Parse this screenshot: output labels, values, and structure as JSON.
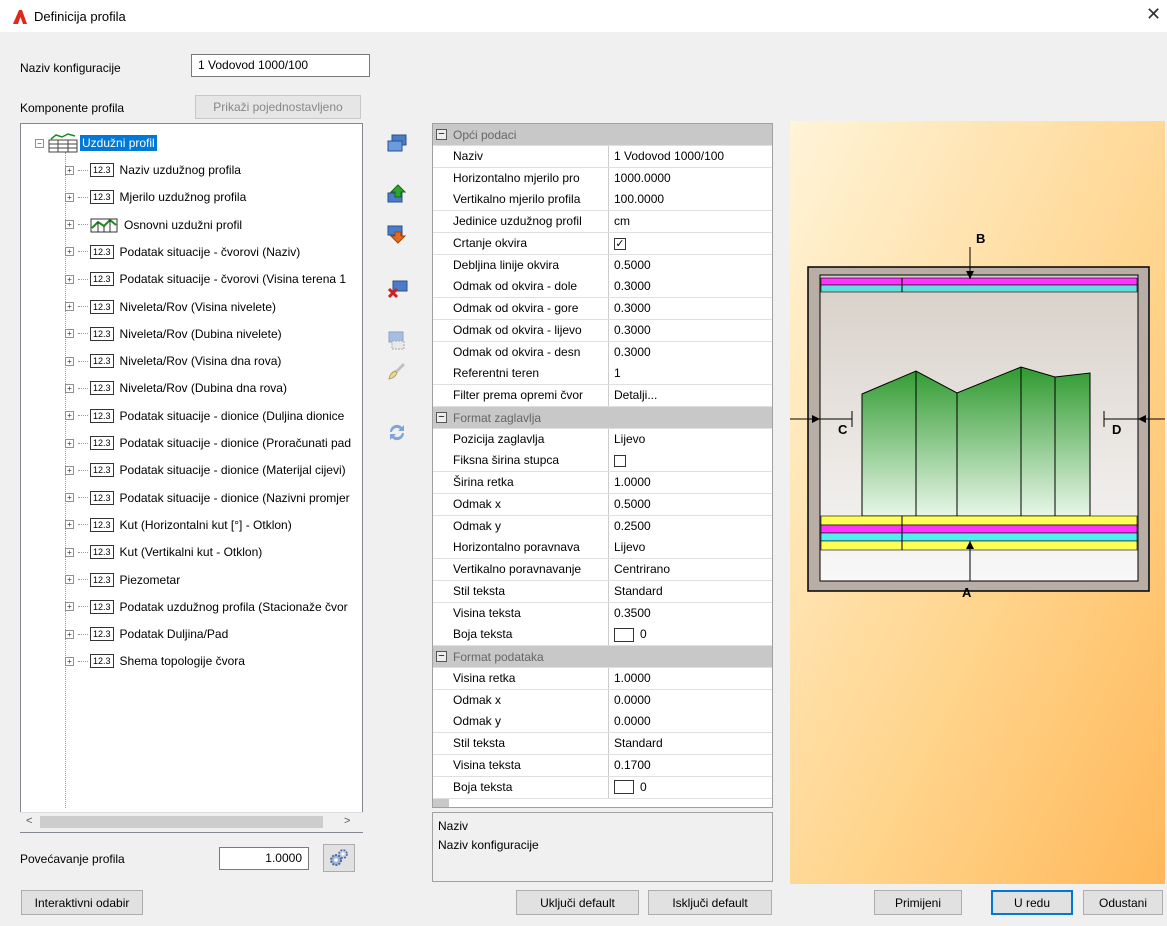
{
  "window": {
    "title": "Definicija profila"
  },
  "config": {
    "label": "Naziv konfiguracije",
    "value": "1 Vodovod 1000/100"
  },
  "components": {
    "label": "Komponente profila",
    "simplified_button": "Prikaži pojednostavljeno"
  },
  "tree": {
    "root": "Uzdužni profil",
    "icon_badge": "12.3",
    "items": [
      "Naziv uzdužnog profila",
      "Mjerilo uzdužnog profila",
      "Osnovni uzdužni profil",
      "Podatak situacije - čvorovi (Naziv)",
      "Podatak situacije - čvorovi (Visina terena 1",
      "Niveleta/Rov (Visina nivelete)",
      "Niveleta/Rov (Dubina nivelete)",
      "Niveleta/Rov (Visina dna rova)",
      "Niveleta/Rov (Dubina dna rova)",
      "Podatak situacije - dionice (Duljina dionice",
      "Podatak situacije - dionice (Proračunati pad",
      "Podatak situacije - dionice (Materijal cijevi)",
      "Podatak situacije - dionice (Nazivni promjer",
      "Kut (Horizontalni kut [°] - Otklon)",
      "Kut (Vertikalni kut - Otklon)",
      "Piezometar",
      "Podatak uzdužnog profila (Stacionaže čvor",
      "Podatak Duljina/Pad",
      "Shema topologije čvora"
    ]
  },
  "zoom": {
    "label": "Povećavanje profila",
    "value": "1.0000"
  },
  "props": {
    "general": {
      "title": "Opći podaci",
      "rows": [
        {
          "name": "Naziv",
          "value": "1 Vodovod 1000/100"
        },
        {
          "name": "Horizontalno mjerilo pro",
          "value": "1000.0000"
        },
        {
          "name": "Vertikalno mjerilo profila",
          "value": "100.0000"
        },
        {
          "name": "Jedinice uzdužnog profil",
          "value": "cm"
        },
        {
          "name": "Crtanje okvira",
          "value": "",
          "checked": true
        },
        {
          "name": "Debljina linije okvira",
          "value": "0.5000"
        },
        {
          "name": "Odmak od okvira - dole",
          "value": "0.3000"
        },
        {
          "name": "Odmak od okvira - gore",
          "value": "0.3000"
        },
        {
          "name": "Odmak od okvira - lijevo",
          "value": "0.3000"
        },
        {
          "name": "Odmak od okvira - desn",
          "value": "0.3000"
        },
        {
          "name": "Referentni teren",
          "value": "1"
        },
        {
          "name": "Filter prema opremi čvor",
          "value": "Detalji..."
        }
      ]
    },
    "header": {
      "title": "Format zaglavlja",
      "rows": [
        {
          "name": "Pozicija zaglavlja",
          "value": "Lijevo"
        },
        {
          "name": "Fiksna širina stupca",
          "value": "",
          "checked": false
        },
        {
          "name": "Širina retka",
          "value": "1.0000"
        },
        {
          "name": "Odmak x",
          "value": "0.5000"
        },
        {
          "name": "Odmak y",
          "value": "0.2500"
        },
        {
          "name": "Horizontalno poravnava",
          "value": "Lijevo"
        },
        {
          "name": "Vertikalno poravnavanje",
          "value": "Centrirano"
        },
        {
          "name": "Stil teksta",
          "value": "Standard"
        },
        {
          "name": "Visina teksta",
          "value": "0.3500"
        },
        {
          "name": "Boja teksta",
          "value": "0",
          "swatch": true
        }
      ]
    },
    "data": {
      "title": "Format podataka",
      "rows": [
        {
          "name": "Visina retka",
          "value": "1.0000"
        },
        {
          "name": "Odmak x",
          "value": "0.0000"
        },
        {
          "name": "Odmak y",
          "value": "0.0000"
        },
        {
          "name": "Stil teksta",
          "value": "Standard"
        },
        {
          "name": "Visina teksta",
          "value": "0.1700"
        },
        {
          "name": "Boja teksta",
          "value": "0",
          "swatch": true
        }
      ]
    }
  },
  "description": {
    "title": "Naziv",
    "text": "Naziv konfiguracije"
  },
  "preview": {
    "labels": {
      "a": "A",
      "b": "B",
      "c": "C",
      "d": "D"
    }
  },
  "buttons": {
    "interactive": "Interaktivni odabir",
    "enable_default": "Uključi default",
    "disable_default": "Isključi default",
    "apply": "Primijeni",
    "ok": "U redu",
    "cancel": "Odustani"
  },
  "colors": {
    "accent": "#0078d7",
    "selection": "#0078d7",
    "magenta": "#ff33ff",
    "cyan": "#33eeee",
    "yellow": "#ffff66",
    "green": "#33aa33"
  }
}
